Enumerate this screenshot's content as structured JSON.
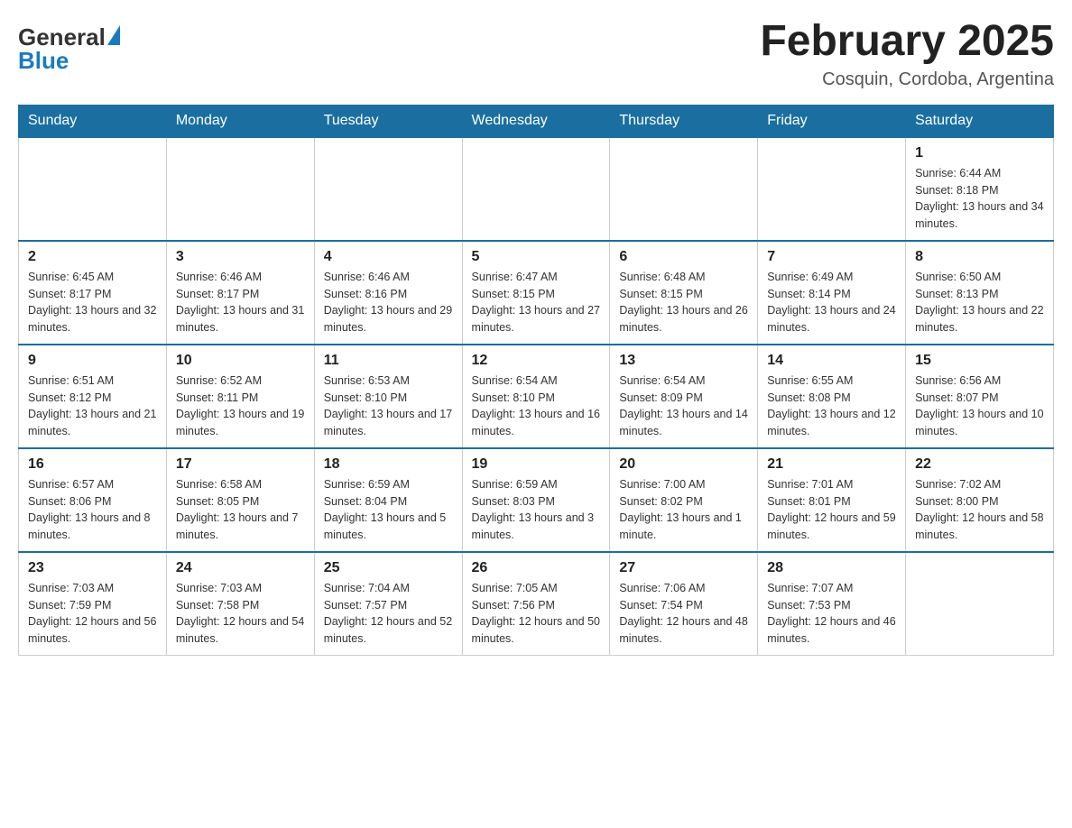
{
  "header": {
    "logo_general": "General",
    "logo_blue": "Blue",
    "month_title": "February 2025",
    "location": "Cosquin, Cordoba, Argentina"
  },
  "days_of_week": [
    "Sunday",
    "Monday",
    "Tuesday",
    "Wednesday",
    "Thursday",
    "Friday",
    "Saturday"
  ],
  "weeks": [
    {
      "cells": [
        {
          "empty": true
        },
        {
          "empty": true
        },
        {
          "empty": true
        },
        {
          "empty": true
        },
        {
          "empty": true
        },
        {
          "empty": true
        },
        {
          "day": 1,
          "sunrise": "6:44 AM",
          "sunset": "8:18 PM",
          "daylight": "13 hours and 34 minutes."
        }
      ]
    },
    {
      "cells": [
        {
          "day": 2,
          "sunrise": "6:45 AM",
          "sunset": "8:17 PM",
          "daylight": "13 hours and 32 minutes."
        },
        {
          "day": 3,
          "sunrise": "6:46 AM",
          "sunset": "8:17 PM",
          "daylight": "13 hours and 31 minutes."
        },
        {
          "day": 4,
          "sunrise": "6:46 AM",
          "sunset": "8:16 PM",
          "daylight": "13 hours and 29 minutes."
        },
        {
          "day": 5,
          "sunrise": "6:47 AM",
          "sunset": "8:15 PM",
          "daylight": "13 hours and 27 minutes."
        },
        {
          "day": 6,
          "sunrise": "6:48 AM",
          "sunset": "8:15 PM",
          "daylight": "13 hours and 26 minutes."
        },
        {
          "day": 7,
          "sunrise": "6:49 AM",
          "sunset": "8:14 PM",
          "daylight": "13 hours and 24 minutes."
        },
        {
          "day": 8,
          "sunrise": "6:50 AM",
          "sunset": "8:13 PM",
          "daylight": "13 hours and 22 minutes."
        }
      ]
    },
    {
      "cells": [
        {
          "day": 9,
          "sunrise": "6:51 AM",
          "sunset": "8:12 PM",
          "daylight": "13 hours and 21 minutes."
        },
        {
          "day": 10,
          "sunrise": "6:52 AM",
          "sunset": "8:11 PM",
          "daylight": "13 hours and 19 minutes."
        },
        {
          "day": 11,
          "sunrise": "6:53 AM",
          "sunset": "8:10 PM",
          "daylight": "13 hours and 17 minutes."
        },
        {
          "day": 12,
          "sunrise": "6:54 AM",
          "sunset": "8:10 PM",
          "daylight": "13 hours and 16 minutes."
        },
        {
          "day": 13,
          "sunrise": "6:54 AM",
          "sunset": "8:09 PM",
          "daylight": "13 hours and 14 minutes."
        },
        {
          "day": 14,
          "sunrise": "6:55 AM",
          "sunset": "8:08 PM",
          "daylight": "13 hours and 12 minutes."
        },
        {
          "day": 15,
          "sunrise": "6:56 AM",
          "sunset": "8:07 PM",
          "daylight": "13 hours and 10 minutes."
        }
      ]
    },
    {
      "cells": [
        {
          "day": 16,
          "sunrise": "6:57 AM",
          "sunset": "8:06 PM",
          "daylight": "13 hours and 8 minutes."
        },
        {
          "day": 17,
          "sunrise": "6:58 AM",
          "sunset": "8:05 PM",
          "daylight": "13 hours and 7 minutes."
        },
        {
          "day": 18,
          "sunrise": "6:59 AM",
          "sunset": "8:04 PM",
          "daylight": "13 hours and 5 minutes."
        },
        {
          "day": 19,
          "sunrise": "6:59 AM",
          "sunset": "8:03 PM",
          "daylight": "13 hours and 3 minutes."
        },
        {
          "day": 20,
          "sunrise": "7:00 AM",
          "sunset": "8:02 PM",
          "daylight": "13 hours and 1 minute."
        },
        {
          "day": 21,
          "sunrise": "7:01 AM",
          "sunset": "8:01 PM",
          "daylight": "12 hours and 59 minutes."
        },
        {
          "day": 22,
          "sunrise": "7:02 AM",
          "sunset": "8:00 PM",
          "daylight": "12 hours and 58 minutes."
        }
      ]
    },
    {
      "cells": [
        {
          "day": 23,
          "sunrise": "7:03 AM",
          "sunset": "7:59 PM",
          "daylight": "12 hours and 56 minutes."
        },
        {
          "day": 24,
          "sunrise": "7:03 AM",
          "sunset": "7:58 PM",
          "daylight": "12 hours and 54 minutes."
        },
        {
          "day": 25,
          "sunrise": "7:04 AM",
          "sunset": "7:57 PM",
          "daylight": "12 hours and 52 minutes."
        },
        {
          "day": 26,
          "sunrise": "7:05 AM",
          "sunset": "7:56 PM",
          "daylight": "12 hours and 50 minutes."
        },
        {
          "day": 27,
          "sunrise": "7:06 AM",
          "sunset": "7:54 PM",
          "daylight": "12 hours and 48 minutes."
        },
        {
          "day": 28,
          "sunrise": "7:07 AM",
          "sunset": "7:53 PM",
          "daylight": "12 hours and 46 minutes."
        },
        {
          "empty": true
        }
      ]
    }
  ]
}
